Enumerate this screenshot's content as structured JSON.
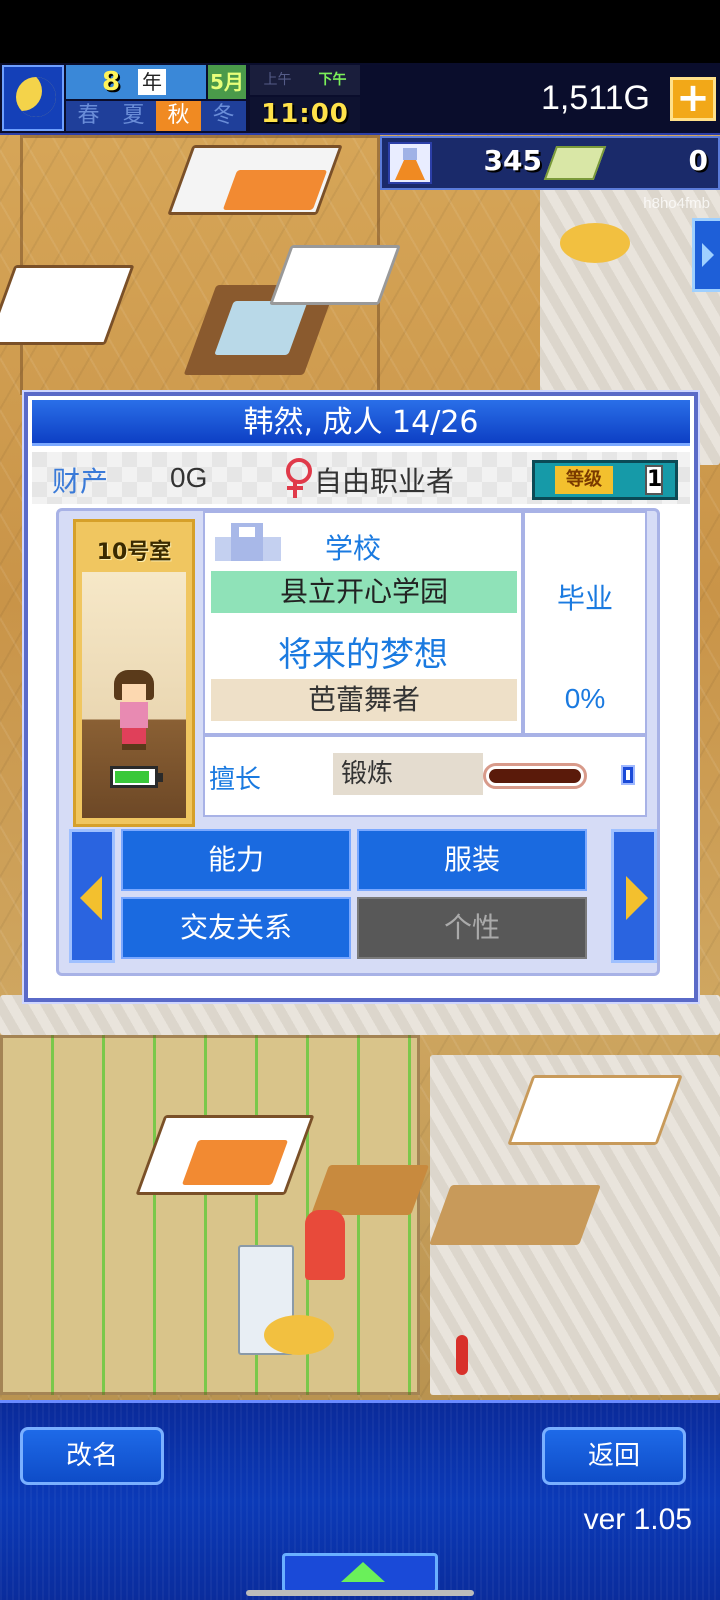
{
  "hud": {
    "year_number": "8",
    "year_unit": "年",
    "month": "5月",
    "seasons": [
      "春",
      "夏",
      "秋",
      "冬"
    ],
    "active_season": "秋",
    "am_label": "上午",
    "pm_label": "下午",
    "active_period": "下午",
    "time": "11:00",
    "money": "1,511G",
    "research_points": "345",
    "tickets": "0",
    "watermark": "h8ho4fmb"
  },
  "profile": {
    "title": "韩然, 成人 14/26",
    "asset_label": "财产",
    "asset_value": "0G",
    "job": "自由职业者",
    "level_label": "等级",
    "level_value": "1",
    "room": "10号室",
    "school_heading": "学校",
    "school_name": "县立开心学园",
    "school_status": "毕业",
    "dream_heading": "将来的梦想",
    "dream": "芭蕾舞者",
    "dream_progress": "0%",
    "skill_label": "擅长",
    "skill": "锻炼"
  },
  "menu": {
    "ability": "能力",
    "clothing": "服装",
    "relationships": "交友关系",
    "personality": "个性"
  },
  "footer": {
    "rename": "改名",
    "back": "返回",
    "version": "ver 1.05"
  },
  "colors": {
    "panel_blue": "#1a6ae0",
    "active_season": "#f08a22",
    "gold": "#f3c02e"
  }
}
